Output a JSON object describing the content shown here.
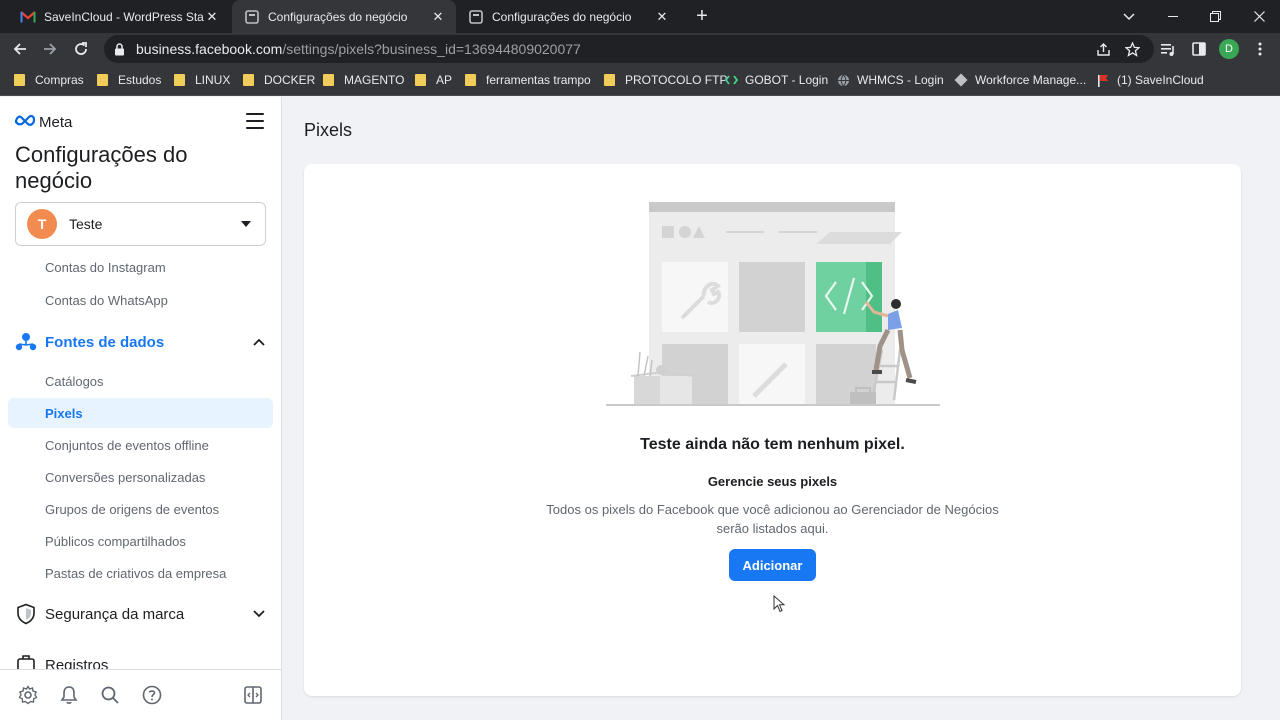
{
  "browser": {
    "tabs": [
      {
        "title": "SaveInCloud - WordPress Standard",
        "active": false,
        "favicon": "gmail-icon"
      },
      {
        "title": "Configurações do negócio",
        "active": true,
        "favicon": "page-icon"
      },
      {
        "title": "Configurações do negócio",
        "active": false,
        "favicon": "page-icon"
      }
    ],
    "tab_close": "✕",
    "new_tab": "+",
    "url_host": "business.facebook.com",
    "url_path": "/settings/pixels?business_id=136944809020077",
    "profile_initial": "D",
    "bookmarks": [
      {
        "label": "Compras",
        "icon": "folder-icon"
      },
      {
        "label": "Estudos",
        "icon": "folder-icon"
      },
      {
        "label": "LINUX",
        "icon": "folder-icon"
      },
      {
        "label": "DOCKER",
        "icon": "folder-icon"
      },
      {
        "label": "MAGENTO",
        "icon": "folder-icon"
      },
      {
        "label": "AP",
        "icon": "folder-icon"
      },
      {
        "label": "ferramentas trampo",
        "icon": "folder-icon"
      },
      {
        "label": "PROTOCOLO FTP",
        "icon": "folder-icon"
      },
      {
        "label": "GOBOT - Login",
        "icon": "gobot-icon"
      },
      {
        "label": "WHMCS - Login",
        "icon": "globe-icon"
      },
      {
        "label": "Workforce Manage...",
        "icon": "diamond-icon"
      },
      {
        "label": "(1) SaveInCloud",
        "icon": "flag-icon"
      }
    ]
  },
  "sidebar": {
    "logo": "Meta",
    "title": "Configurações do negócio",
    "account": {
      "initial": "T",
      "name": "Teste"
    },
    "items_top": [
      "Contas do Instagram",
      "Contas do WhatsApp"
    ],
    "section_data": {
      "label": "Fontes de dados"
    },
    "data_items": [
      "Catálogos",
      "Pixels",
      "Conjuntos de eventos offline",
      "Conversões personalizadas",
      "Grupos de origens de eventos",
      "Públicos compartilhados",
      "Pastas de criativos da empresa"
    ],
    "selected_item": "Pixels",
    "section_brand": {
      "label": "Segurança da marca"
    },
    "section_cut": {
      "label": "Registros"
    }
  },
  "main": {
    "page_title": "Pixels",
    "empty_title": "Teste ainda não tem nenhum pixel.",
    "empty_subtitle": "Gerencie seus pixels",
    "empty_description": "Todos os pixels do Facebook que você adicionou ao Gerenciador de Negócios serão listados aqui.",
    "add_button": "Adicionar"
  },
  "colors": {
    "accent": "#1877f2",
    "selected_bg": "#e7f3ff",
    "avatar": "#f28b50",
    "illustration_green": "#6fd1a0"
  }
}
